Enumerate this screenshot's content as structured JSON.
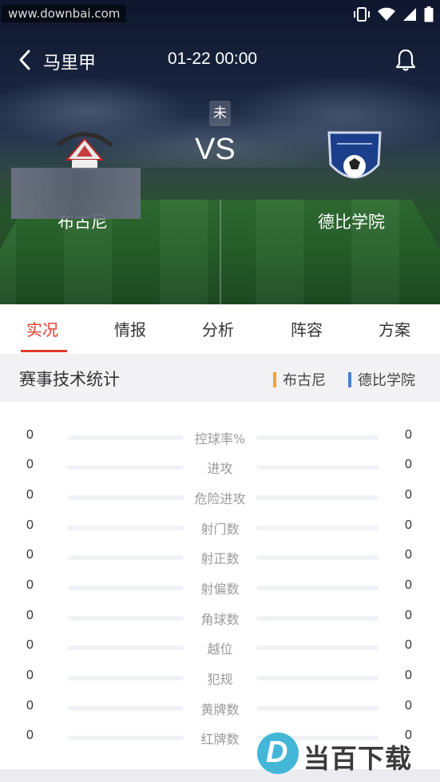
{
  "statusbar": {
    "watermark": "www.downbai.com"
  },
  "nav": {
    "league": "马里甲",
    "match_time": "01-22 00:00"
  },
  "match": {
    "status": "未",
    "vs": "VS",
    "home_team": "布古尼",
    "away_team": "德比学院"
  },
  "tabs": [
    "实况",
    "情报",
    "分析",
    "阵容",
    "方案"
  ],
  "active_tab": "实况",
  "section": {
    "title": "赛事技术统计",
    "legend_home": "布古尼",
    "legend_away": "德比学院"
  },
  "colors": {
    "accent": "#e23a2a",
    "home": "#f5a03a",
    "away": "#4a7fd8"
  },
  "stats": [
    {
      "label": "控球率%",
      "home": "0",
      "away": "0"
    },
    {
      "label": "进攻",
      "home": "0",
      "away": "0"
    },
    {
      "label": "危险进攻",
      "home": "0",
      "away": "0"
    },
    {
      "label": "射门数",
      "home": "0",
      "away": "0"
    },
    {
      "label": "射正数",
      "home": "0",
      "away": "0"
    },
    {
      "label": "射偏数",
      "home": "0",
      "away": "0"
    },
    {
      "label": "角球数",
      "home": "0",
      "away": "0"
    },
    {
      "label": "越位",
      "home": "0",
      "away": "0"
    },
    {
      "label": "犯规",
      "home": "0",
      "away": "0"
    },
    {
      "label": "黄牌数",
      "home": "0",
      "away": "0"
    },
    {
      "label": "红牌数",
      "home": "0",
      "away": "0"
    }
  ],
  "brand": {
    "badge": "D",
    "text": "当百下载"
  },
  "icons": {
    "back": "chevron-left-icon",
    "bell": "bell-icon",
    "vibrate": "vibrate-icon",
    "wifi": "wifi-icon",
    "signal": "signal-icon",
    "battery": "battery-icon"
  }
}
